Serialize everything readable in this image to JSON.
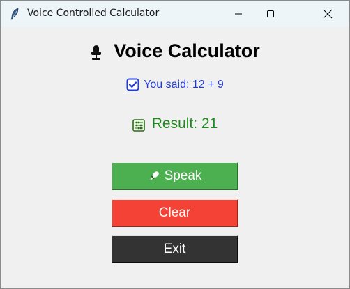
{
  "window": {
    "title": "Voice Controlled Calculator",
    "controls": [
      "minimize-icon",
      "maximize-icon",
      "close-icon"
    ]
  },
  "app": {
    "heading": "Voice Calculator",
    "heading_icon": "microphone-icon",
    "said_text": "You said: 12 + 9",
    "said_icon": "checkbox-icon",
    "result_text": "Result: 21",
    "result_icon": "abacus-icon"
  },
  "buttons": {
    "speak": "Speak",
    "speak_icon": "microphone-icon",
    "clear": "Clear",
    "exit": "Exit"
  },
  "colors": {
    "speak": "#4caf50",
    "clear": "#f44336",
    "exit": "#333333",
    "said_text": "#1f3bd8",
    "result_text": "#1e8a1e"
  }
}
